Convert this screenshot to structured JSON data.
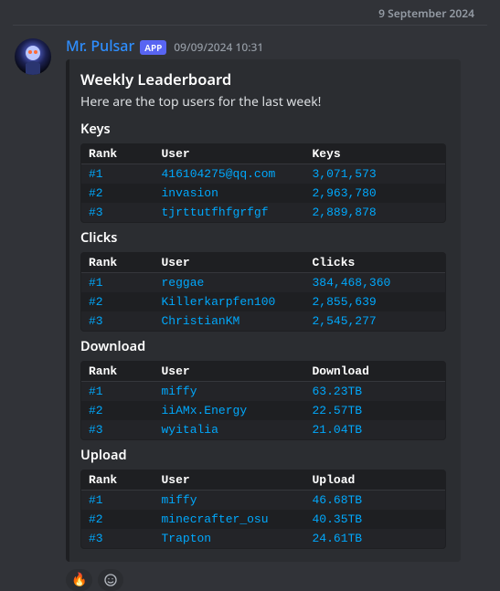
{
  "date_divider": "9 September 2024",
  "message": {
    "username": "Mr. Pulsar",
    "tag": "APP",
    "timestamp": "09/09/2024 10:31"
  },
  "embed": {
    "title": "Weekly Leaderboard",
    "description": "Here are the top users for the last week!",
    "sections": [
      {
        "name": "Keys",
        "headers": [
          "Rank",
          "User",
          "Keys"
        ],
        "rows": [
          [
            "#1",
            "416104275@qq.com",
            "3,071,573"
          ],
          [
            "#2",
            "invasion",
            "2,963,780"
          ],
          [
            "#3",
            "tjrttutfhfgrfgf",
            "2,889,878"
          ]
        ]
      },
      {
        "name": "Clicks",
        "headers": [
          "Rank",
          "User",
          "Clicks"
        ],
        "rows": [
          [
            "#1",
            "reggae",
            "384,468,360"
          ],
          [
            "#2",
            "Killerkarpfen100",
            "2,855,639"
          ],
          [
            "#3",
            "ChristianKM",
            "2,545,277"
          ]
        ]
      },
      {
        "name": "Download",
        "headers": [
          "Rank",
          "User",
          "Download"
        ],
        "rows": [
          [
            "#1",
            "miffy",
            "63.23TB"
          ],
          [
            "#2",
            "iiAMx.Energy",
            "22.57TB"
          ],
          [
            "#3",
            "wyitalia",
            "21.04TB"
          ]
        ]
      },
      {
        "name": "Upload",
        "headers": [
          "Rank",
          "User",
          "Upload"
        ],
        "rows": [
          [
            "#1",
            "miffy",
            "46.68TB"
          ],
          [
            "#2",
            "minecrafter_osu",
            "40.35TB"
          ],
          [
            "#3",
            "Trapton",
            "24.61TB"
          ]
        ]
      }
    ]
  }
}
